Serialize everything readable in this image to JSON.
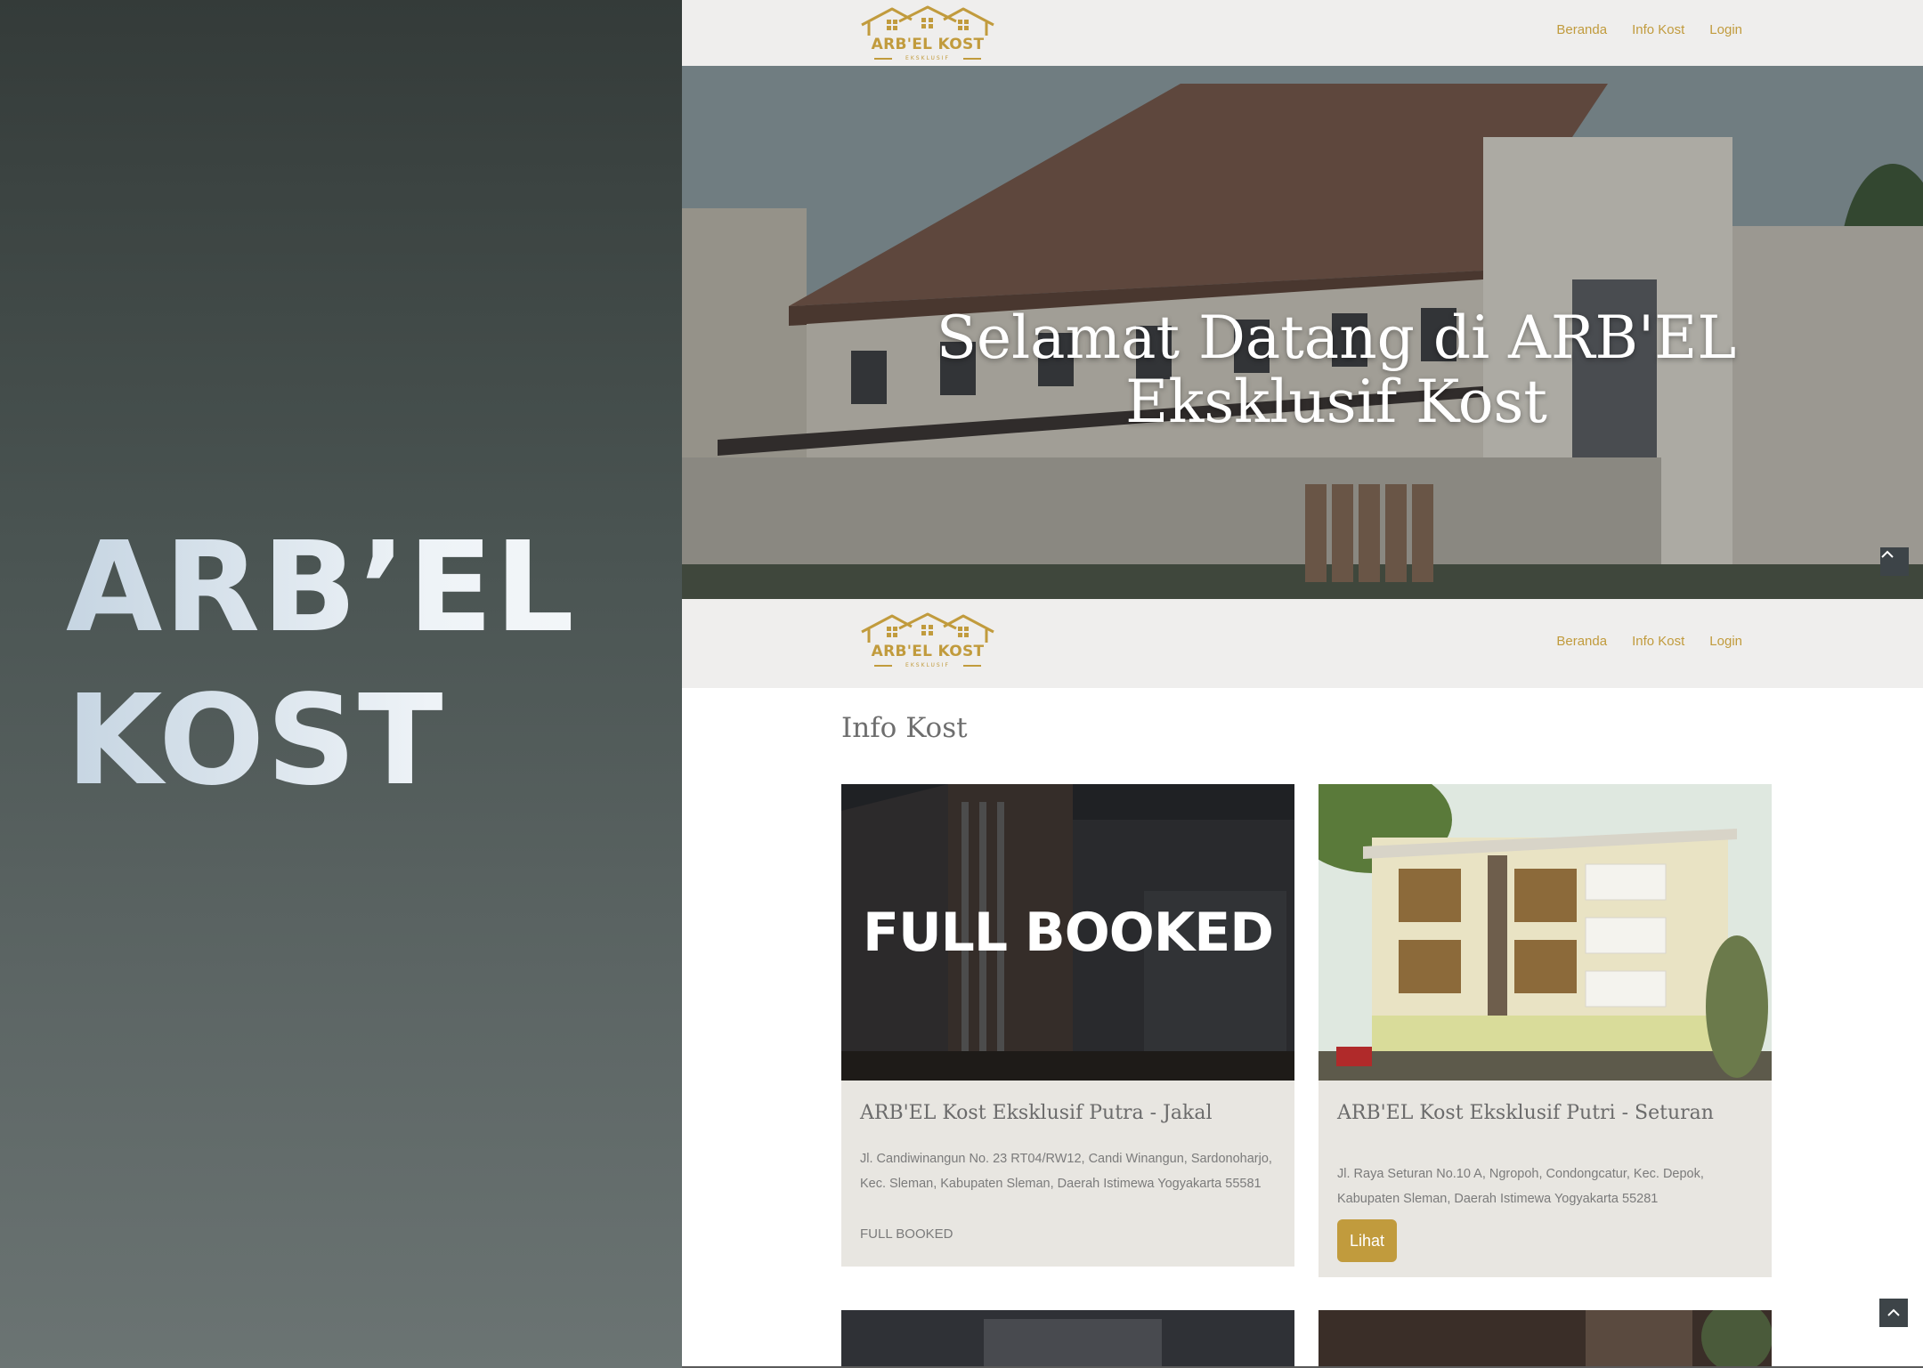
{
  "promo": {
    "title_line1": "ARB’EL",
    "title_line2": "KOST"
  },
  "brand": {
    "logo_text": "ARB'EL KOST",
    "logo_sub": "EKSKLUSIF",
    "accent_color": "#c19b3d"
  },
  "nav": {
    "items": [
      {
        "label": "Beranda"
      },
      {
        "label": "Info Kost"
      },
      {
        "label": "Login"
      }
    ]
  },
  "hero": {
    "title": "Selamat Datang di ARB'EL Eksklusif Kost"
  },
  "info": {
    "section_title": "Info Kost",
    "cards": [
      {
        "title": "ARB'EL Kost Eksklusif Putra - Jakal",
        "address": "Jl. Candiwinangun No. 23 RT04/RW12, Candi Winangun, Sardonoharjo, Kec. Sleman, Kabupaten Sleman, Daerah Istimewa Yogyakarta 55581",
        "image_overlay": "FULL BOOKED",
        "status": "FULL BOOKED"
      },
      {
        "title": "ARB'EL Kost Eksklusif Putri - Seturan",
        "address": "Jl. Raya Seturan No.10 A, Ngropoh, Condongcatur, Kec. Depok, Kabupaten Sleman, Daerah Istimewa Yogyakarta 55281",
        "button": "Lihat"
      }
    ]
  },
  "icons": {
    "scroll_top": "chevron-up-icon"
  }
}
